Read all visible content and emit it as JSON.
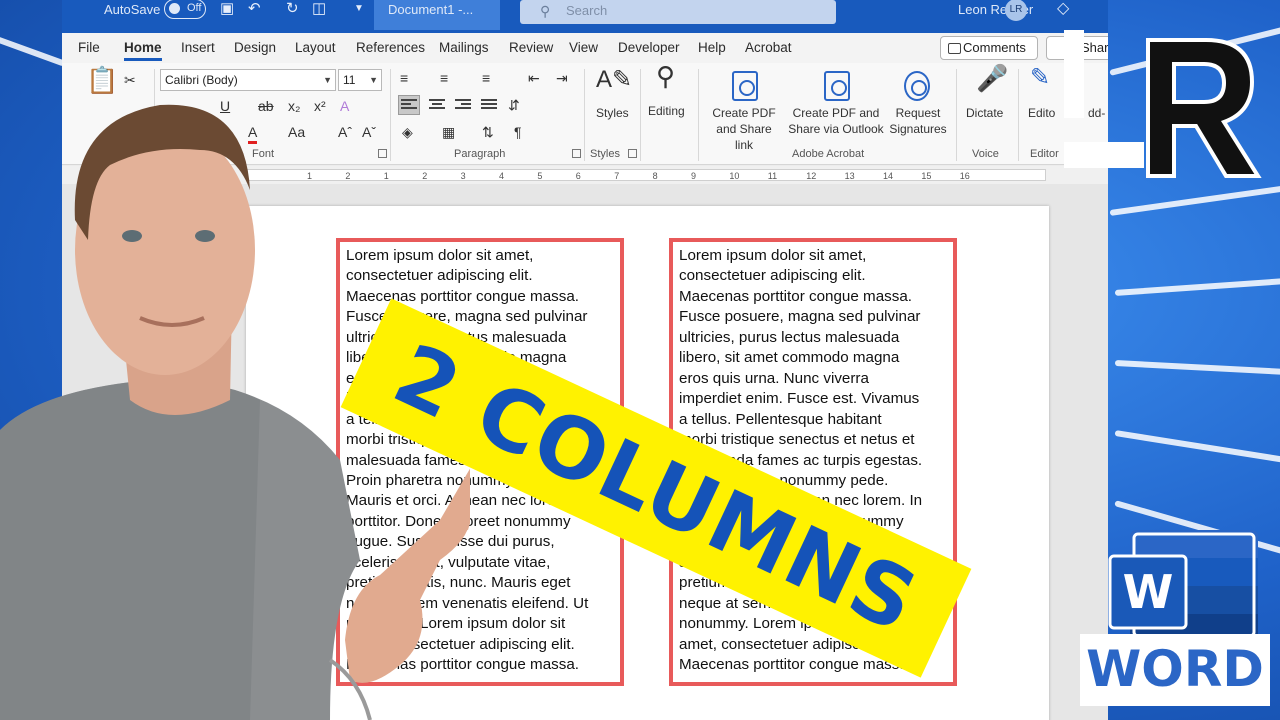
{
  "titlebar": {
    "autosave_label": "AutoSave",
    "autosave_state": "Off",
    "document_title": "Document1  -...",
    "search_placeholder": "Search",
    "user_name": "Leon Renner",
    "user_initials": "LR"
  },
  "menu": {
    "tabs": [
      "File",
      "Home",
      "Insert",
      "Design",
      "Layout",
      "References",
      "Mailings",
      "Review",
      "View",
      "Developer",
      "Help",
      "Acrobat"
    ],
    "active_tab": "Home",
    "comments_label": "Comments",
    "share_label": "Sharing"
  },
  "ribbon": {
    "font_name": "Calibri (Body)",
    "font_size": "11",
    "group_font": "Font",
    "group_paragraph": "Paragraph",
    "group_styles": "Styles",
    "styles_label": "Styles",
    "editing_label": "Editing",
    "create_pdf_label": "Create PDF\nand Share link",
    "create_pdf_outlook_label": "Create PDF and\nShare via Outlook",
    "request_signatures_label": "Request\nSignatures",
    "group_acrobat": "Adobe Acrobat",
    "dictate_label": "Dictate",
    "group_voice": "Voice",
    "editor_label": "Edito",
    "group_editor": "Editor",
    "addins_label": "dd-"
  },
  "ruler": {
    "numbers": [
      "1",
      "2",
      "1",
      "2",
      "3",
      "4",
      "5",
      "6",
      "7",
      "8",
      "9",
      "10",
      "11",
      "12",
      "13",
      "14",
      "15",
      "16"
    ]
  },
  "document": {
    "column_left": "Lorem ipsum dolor sit amet,\nconsectetuer adipiscing elit.\nMaecenas porttitor congue massa.\nFusce posuere, magna sed pulvinar\nultricies, purus lectus malesuada\nlibero, sit amet commodo magna\neros quis urna. Nunc viverra\nimperdiet enim. Fusce est. Vivamus\na tellus. Pellentesque habitant\nmorbi tristique senectus et netus et\nmalesuada fames ac turpis egestas.\nProin pharetra nonummy pede.\nMauris et orci. Aenean nec lorem. In\nporttitor. Donec laoreet nonummy\naugue. Suspendisse dui purus,\nscelerisque at, vulputate vitae,\npretium mattis, nunc. Mauris eget\nneque at sem venenatis eleifend. Ut\nnonummy. Lorem ipsum dolor sit\namet, consectetuer adipiscing elit.\nMaecenas porttitor congue massa.",
    "column_right": "Lorem ipsum dolor sit amet,\nconsectetuer adipiscing elit.\nMaecenas porttitor congue massa.\nFusce posuere, magna sed pulvinar\nultricies, purus lectus malesuada\nlibero, sit amet commodo magna\neros quis urna. Nunc viverra\nimperdiet enim. Fusce est. Vivamus\na tellus. Pellentesque habitant\nmorbi tristique senectus et netus et\nmalesuada fames ac turpis egestas.\nProin pharetra nonummy pede.\nMauris et orci. Aenean nec lorem. In\nporttitor. Donec laoreet nonummy\naugue. Suspendisse dui purus,\nscelerisque at, vulputate vitae,\npretium mattis, nunc. Mauris eget\nneque at sem venenatis eleifend. Ut\nnonummy. Lorem ipsum dolor sit\namet, consectetuer adipiscing elit.\nMaecenas porttitor congue massa."
  },
  "overlay": {
    "banner_text": "2 COLUMNS",
    "logo_letters": "LR",
    "word_logo_letter": "W",
    "word_logo_label": "WORD"
  },
  "colors": {
    "word_blue": "#185abd",
    "column_border": "#e85a5a",
    "banner_yellow": "#fff200",
    "banner_text": "#1553b8",
    "background_blue": "#2e7ae0"
  }
}
